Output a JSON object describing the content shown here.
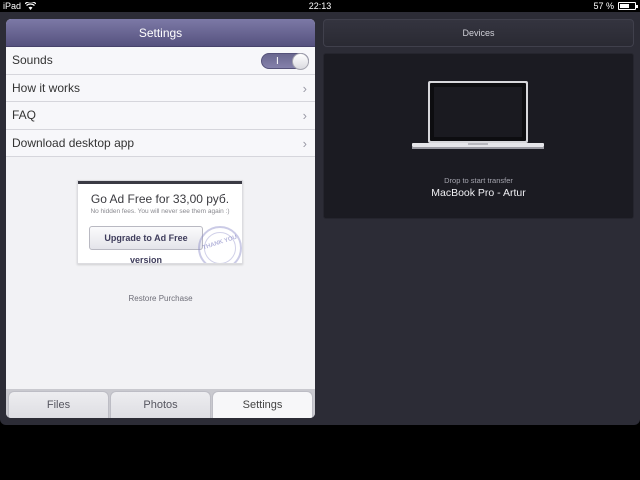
{
  "status_bar": {
    "device": "iPad",
    "time": "22:13",
    "battery": "57 %",
    "battery_level": 0.57
  },
  "settings": {
    "title": "Settings",
    "rows": [
      {
        "label": "Sounds",
        "toggle": "on",
        "toggle_label": "I"
      },
      {
        "label": "How it works",
        "chevron": "›"
      },
      {
        "label": "FAQ",
        "chevron": "›"
      },
      {
        "label": "Download desktop app",
        "chevron": "›"
      }
    ],
    "ad": {
      "title": "Go Ad Free for 33,00 руб.",
      "subtitle": "No hidden fees. You will never see them again :)",
      "button": "Upgrade to Ad Free version",
      "stamp": "THANK YOU"
    },
    "restore": "Restore Purchase"
  },
  "tabs": [
    {
      "label": "Files",
      "active": false
    },
    {
      "label": "Photos",
      "active": false
    },
    {
      "label": "Settings",
      "active": true
    }
  ],
  "devices": {
    "title": "Devices",
    "hint": "Drop to start transfer",
    "device_name": "MacBook Pro - Artur",
    "device_icon": "laptop-icon"
  },
  "colors": {
    "accent": "#6a678f",
    "background": "#2c2c36",
    "panel": "#1b1b22"
  }
}
